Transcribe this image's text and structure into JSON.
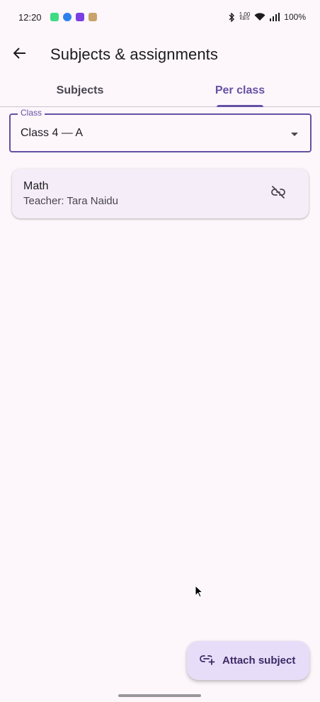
{
  "status_bar": {
    "time": "12:20",
    "speed": "1.00",
    "speed_unit": "KB/S",
    "battery": "100%"
  },
  "app_bar": {
    "back_icon": "arrow-back-icon",
    "title": "Subjects & assignments"
  },
  "tabs": [
    {
      "label": "Subjects",
      "active": false
    },
    {
      "label": "Per class",
      "active": true
    }
  ],
  "class_select": {
    "label": "Class",
    "value": "Class 4 — A"
  },
  "assignments": [
    {
      "subject": "Math",
      "teacher": "Teacher: Tara Naidu",
      "action_icon": "link-off-icon"
    }
  ],
  "fab": {
    "icon": "add-link-icon",
    "label": "Attach subject"
  },
  "colors": {
    "primary": "#6750a4",
    "background": "#fdf7fc",
    "card": "#f5eef8",
    "fab": "#e8ddf8"
  }
}
